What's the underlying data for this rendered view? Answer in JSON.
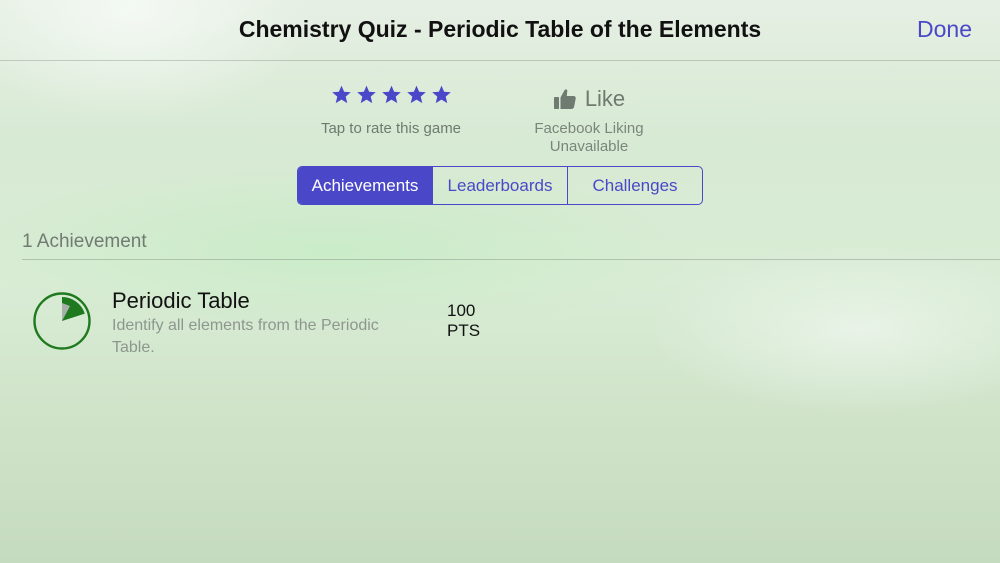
{
  "header": {
    "title": "Chemistry Quiz - Periodic Table of the Elements",
    "done_label": "Done"
  },
  "rating": {
    "stars_count": 5,
    "caption": "Tap to rate this game"
  },
  "like": {
    "label": "Like",
    "caption_line1": "Facebook Liking",
    "caption_line2": "Unavailable"
  },
  "tabs": [
    {
      "label": "Achievements",
      "selected": true
    },
    {
      "label": "Leaderboards",
      "selected": false
    },
    {
      "label": "Challenges",
      "selected": false
    }
  ],
  "section": {
    "header": "1 Achievement"
  },
  "achievements": [
    {
      "title": "Periodic Table",
      "description": "Identify all elements from the Periodic Table.",
      "points_value": "100",
      "points_unit": "PTS",
      "progress": 0.2
    }
  ],
  "colors": {
    "accent": "#4a48c9",
    "progress_green": "#1f7a1f",
    "progress_gray": "#a9b0aa"
  },
  "icons": {
    "star": "star-icon",
    "like": "thumbs-up-icon",
    "achievement": "progress-pie-icon"
  }
}
